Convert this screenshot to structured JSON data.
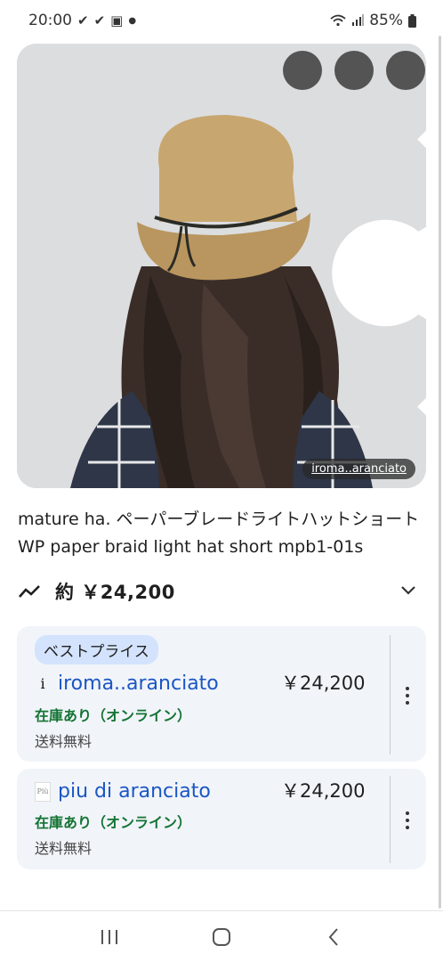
{
  "status_bar": {
    "time": "20:00",
    "notif_icons": [
      "check-icon",
      "check-icon",
      "image-icon",
      "dot-icon"
    ],
    "battery": "85%"
  },
  "hero": {
    "source_label": "iroma..aranciato",
    "buttons": {
      "share": "share-icon",
      "more": "more-vert-icon",
      "close": "close-icon"
    }
  },
  "product": {
    "title": "mature ha. ペーパーブレードライトハットショートWP paper braid light hat short mpb1-01s",
    "price_approx": "約 ￥24,200"
  },
  "offers": [
    {
      "badge": "ベストプライス",
      "logo_text": "i",
      "merchant": "iroma..aranciato",
      "price": "￥24,200",
      "stock": "在庫あり（オンライン）",
      "shipping": "送料無料"
    },
    {
      "logo_text": "Più",
      "merchant": "piu di aranciato",
      "price": "￥24,200",
      "stock": "在庫あり（オンライン）",
      "shipping": "送料無料"
    }
  ],
  "colors": {
    "link_blue": "#1a56c4",
    "stock_green": "#137333",
    "card_bg": "#f1f4f9",
    "badge_bg": "#d3e3fd"
  }
}
